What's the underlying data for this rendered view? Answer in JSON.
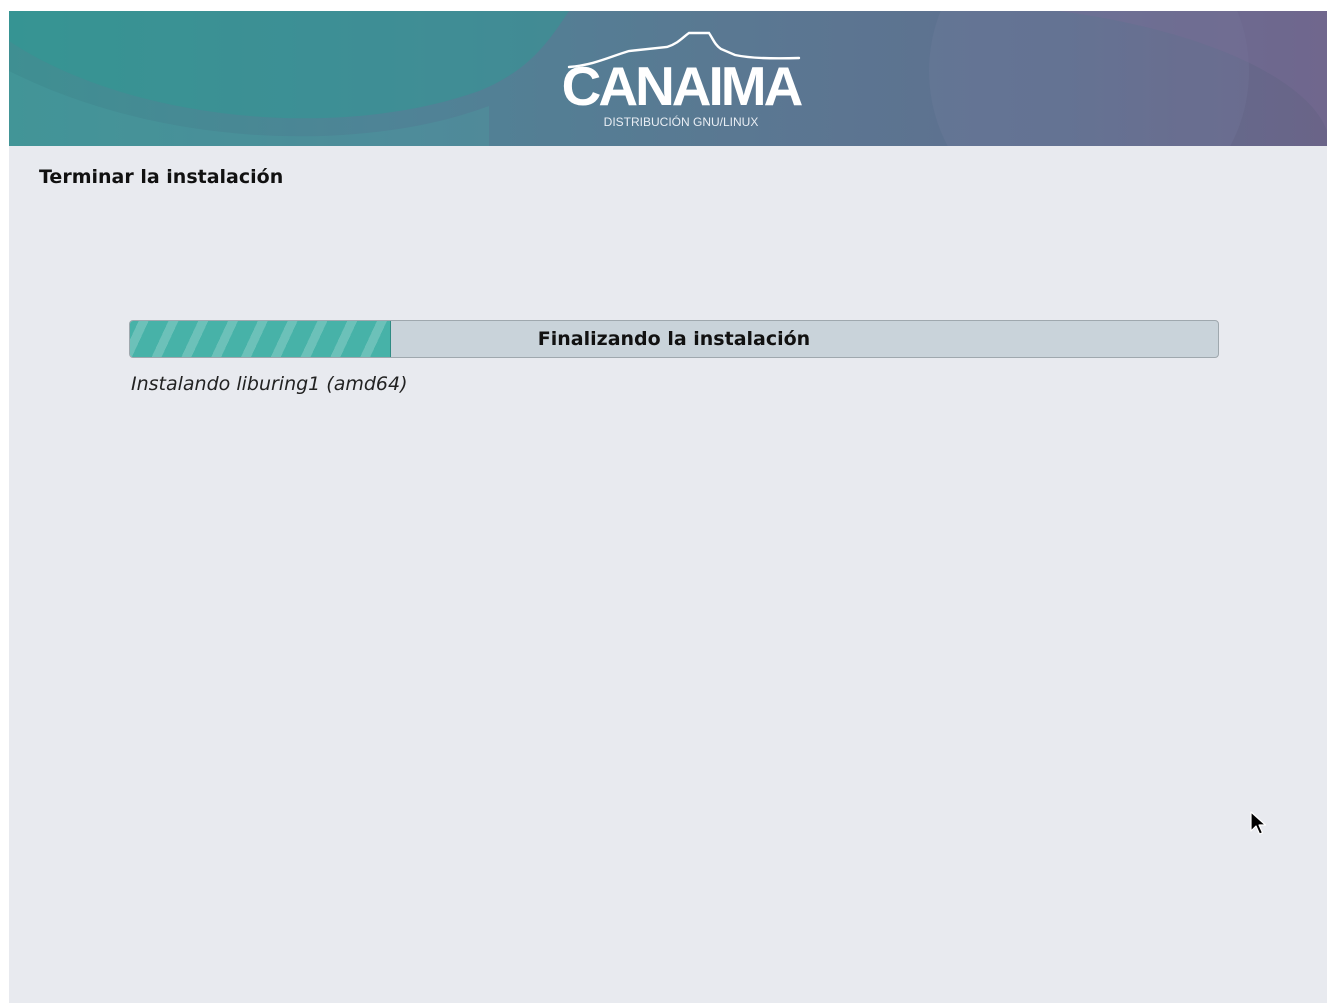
{
  "banner": {
    "logo_text": "CANAIMA",
    "logo_subtitle": "DISTRIBUCIÓN GNU/LINUX",
    "colors": {
      "teal": "#3f8f92",
      "slate": "#5a7892",
      "purple": "#6a6488"
    }
  },
  "step": {
    "title": "Terminar la instalación"
  },
  "progress": {
    "label": "Finalizando la instalación",
    "fraction": 0.24,
    "fill_color": "#47b2a8",
    "status": "Instalando liburing1 (amd64)"
  },
  "cursor": {
    "icon": "pointer-arrow-icon"
  }
}
